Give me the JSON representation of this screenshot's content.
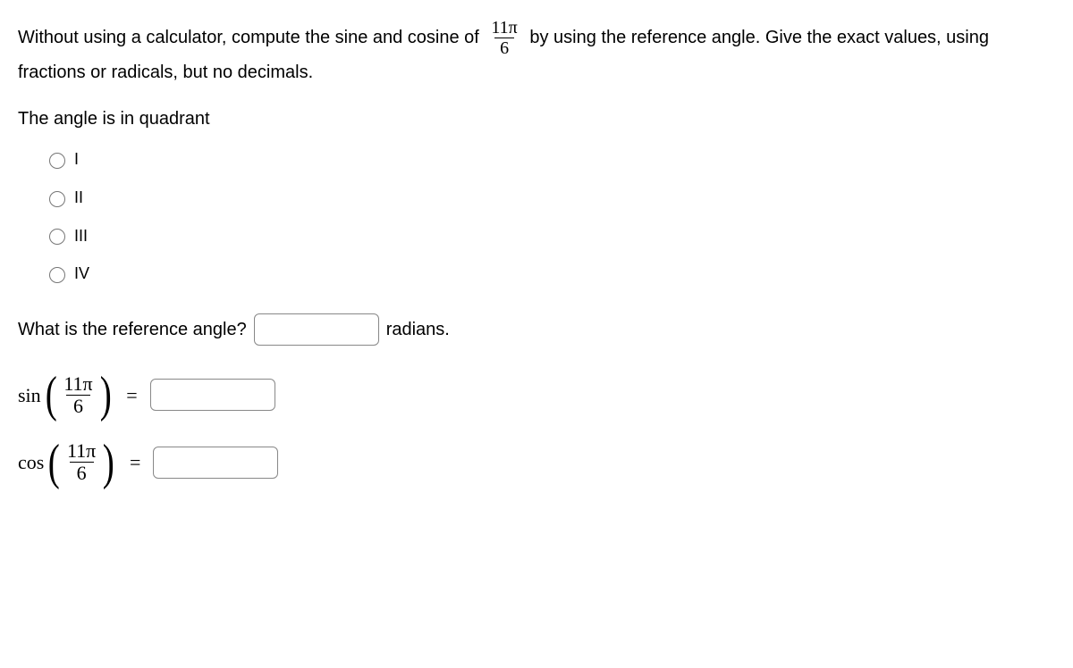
{
  "question": {
    "prefix": "Without using a calculator, compute the sine and cosine of ",
    "fraction_num": "11π",
    "fraction_den": "6",
    "suffix": " by using the reference angle. Give the exact values, using fractions or radicals, but no decimals."
  },
  "quadrant": {
    "label": "The angle is in quadrant",
    "options": [
      "I",
      "II",
      "III",
      "IV"
    ]
  },
  "ref_angle": {
    "label": "What is the reference angle?",
    "unit": "radians."
  },
  "sin_row": {
    "func": "sin",
    "num": "11π",
    "den": "6",
    "equals": "="
  },
  "cos_row": {
    "func": "cos",
    "num": "11π",
    "den": "6",
    "equals": "="
  }
}
